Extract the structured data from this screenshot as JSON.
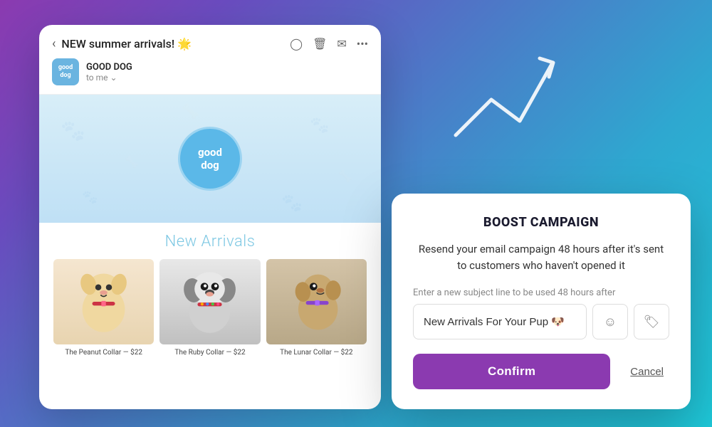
{
  "background": {
    "gradient_start": "#8b3ab0",
    "gradient_end": "#1ec8d8"
  },
  "email_card": {
    "subject": "NEW summer arrivals! 🌟",
    "sender_name": "GOOD DOG",
    "sender_to": "to me",
    "avatar_text": "good\ndog",
    "banner_logo": "good\ndog",
    "new_arrivals_title": "New Arrivals",
    "products": [
      {
        "name": "The Peanut Collar",
        "price": "$22",
        "dog_type": "peanut"
      },
      {
        "name": "The Ruby Collar",
        "price": "$22",
        "dog_type": "ruby"
      },
      {
        "name": "The Lunar Collar",
        "price": "$22",
        "dog_type": "lunar"
      }
    ]
  },
  "boost_modal": {
    "title": "BOOST CAMPAIGN",
    "description": "Resend your email campaign 48 hours after it's sent to customers who haven't opened it",
    "input_label": "Enter a new subject line to be used 48 hours after",
    "input_value": "New Arrivals For Your Pup 🐶",
    "input_placeholder": "New Arrivals For Your Pup 🐶",
    "confirm_label": "Confirm",
    "cancel_label": "Cancel"
  }
}
